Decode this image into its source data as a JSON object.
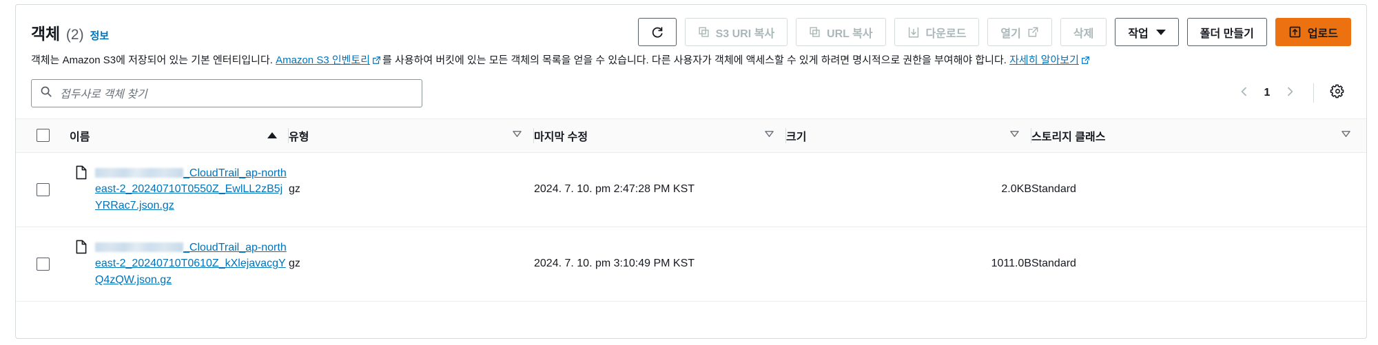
{
  "header": {
    "title": "객체",
    "count": "(2)",
    "info_label": "정보"
  },
  "toolbar": {
    "refresh_icon": "refresh-icon",
    "buttons": [
      {
        "label": "S3 URI 복사",
        "icon": "copy-icon",
        "disabled": true
      },
      {
        "label": "URL 복사",
        "icon": "copy-icon",
        "disabled": true
      },
      {
        "label": "다운로드",
        "icon": "download-icon",
        "disabled": true
      },
      {
        "label": "열기",
        "icon": "external-link-icon",
        "disabled": true
      },
      {
        "label": "삭제",
        "icon": "none",
        "disabled": true
      },
      {
        "label": "작업",
        "icon": "chevron-down-icon",
        "disabled": false
      },
      {
        "label": "폴더 만들기",
        "icon": "none",
        "disabled": false
      }
    ],
    "upload_label": "업로드",
    "upload_icon": "upload-icon",
    "upload_color": "#ec7211"
  },
  "description": {
    "part1": "객체는 Amazon S3에 저장되어 있는 기본 엔터티입니다. ",
    "link1": "Amazon S3 인벤토리",
    "part2": "를 사용하여 버킷에 있는 모든 객체의 목록을 얻을 수 있습니다. 다른 사용자가 객체에 액세스할 수 있게 하려면 명시적으로 권한을 부여해야 합니다. ",
    "link2": "자세히 알아보기"
  },
  "filter": {
    "search_placeholder": "접두사로 객체 찾기",
    "search_value": "",
    "search_icon": "search-icon"
  },
  "pagination": {
    "prev_icon": "chevron-left-icon",
    "next_icon": "chevron-right-icon",
    "current_page": "1",
    "settings_icon": "gear-icon"
  },
  "table": {
    "columns": [
      {
        "label": "이름",
        "sort": "asc"
      },
      {
        "label": "유형",
        "sort": "none"
      },
      {
        "label": "마지막 수정",
        "sort": "none"
      },
      {
        "label": "크기",
        "sort": "none"
      },
      {
        "label": "스토리지 클래스",
        "sort": "none"
      }
    ],
    "rows": [
      {
        "selected": false,
        "file_icon": "file-icon",
        "name_redacted": true,
        "name": "_CloudTrail_ap-northeast-2_20240710T0550Z_EwlLL2zB5jYRRac7.json.gz",
        "type": "gz",
        "last_modified": "2024. 7. 10. pm 2:47:28 PM KST",
        "size": "2.0KB",
        "storage_class": "Standard"
      },
      {
        "selected": false,
        "file_icon": "file-icon",
        "name_redacted": true,
        "name": "_CloudTrail_ap-northeast-2_20240710T0610Z_kXlejavacgYQ4zQW.json.gz",
        "type": "gz",
        "last_modified": "2024. 7. 10. pm 3:10:49 PM KST",
        "size": "1011.0B",
        "storage_class": "Standard"
      }
    ]
  }
}
